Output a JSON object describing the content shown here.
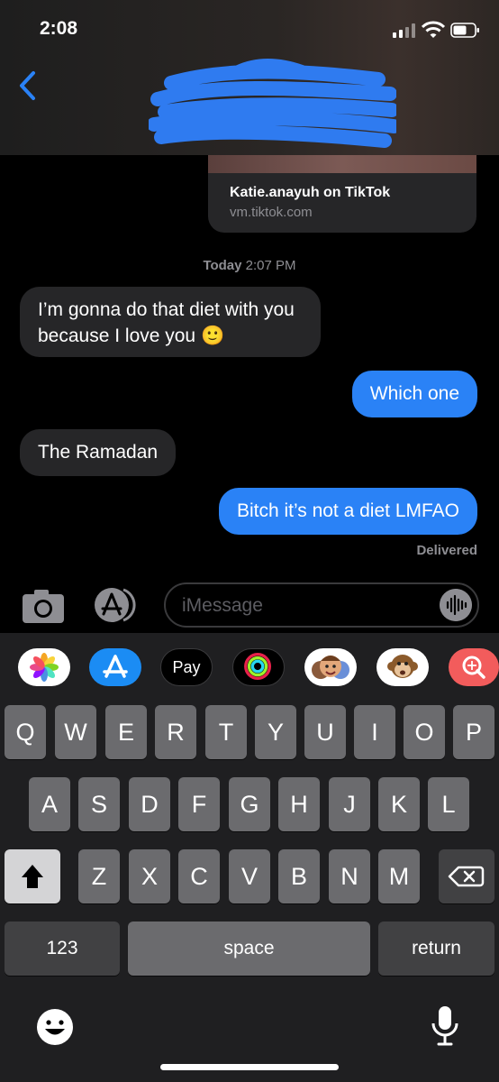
{
  "status_bar": {
    "time": "2:08"
  },
  "link_preview": {
    "title": "Katie.anayuh on TikTok",
    "domain": "vm.tiktok.com"
  },
  "timestamp": {
    "day": "Today",
    "time": "2:07 PM"
  },
  "messages": [
    {
      "direction": "incoming",
      "text": "I’m gonna do that diet with you because I love you 🙂"
    },
    {
      "direction": "outgoing",
      "text": "Which one"
    },
    {
      "direction": "incoming",
      "text": "The Ramadan"
    },
    {
      "direction": "outgoing",
      "text": "Bitch it’s not a diet LMFAO"
    }
  ],
  "delivery_status": "Delivered",
  "input": {
    "placeholder": "iMessage"
  },
  "app_drawer": [
    {
      "name": "Photos",
      "icon": "photos-icon"
    },
    {
      "name": "App Store",
      "icon": "appstore-icon"
    },
    {
      "name": "Apple Pay",
      "label": "Pay",
      "icon": "applepay-icon"
    },
    {
      "name": "Activity",
      "icon": "activity-icon"
    },
    {
      "name": "Memoji",
      "icon": "memoji-icon"
    },
    {
      "name": "Animoji",
      "icon": "monkey-icon"
    },
    {
      "name": "Search Images",
      "icon": "image-search-icon"
    }
  ],
  "keyboard": {
    "row1": [
      "Q",
      "W",
      "E",
      "R",
      "T",
      "Y",
      "U",
      "I",
      "O",
      "P"
    ],
    "row2": [
      "A",
      "S",
      "D",
      "F",
      "G",
      "H",
      "J",
      "K",
      "L"
    ],
    "row3": [
      "Z",
      "X",
      "C",
      "V",
      "B",
      "N",
      "M"
    ],
    "numbers_label": "123",
    "space_label": "space",
    "return_label": "return"
  },
  "colors": {
    "outgoing_bubble": "#2a82f6",
    "incoming_bubble": "#262628",
    "accent": "#2a82f6"
  }
}
